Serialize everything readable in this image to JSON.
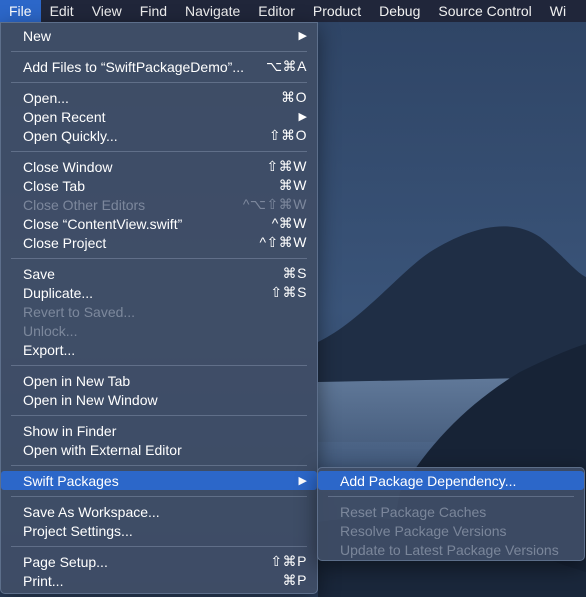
{
  "menubar": {
    "items": [
      "File",
      "Edit",
      "View",
      "Find",
      "Navigate",
      "Editor",
      "Product",
      "Debug",
      "Source Control",
      "Wi"
    ],
    "active": "File"
  },
  "file_menu": {
    "new": "New",
    "add_files": "Add Files to “SwiftPackageDemo”...",
    "add_files_shortcut": "⌥⌘A",
    "open": "Open...",
    "open_shortcut": "⌘O",
    "open_recent": "Open Recent",
    "open_quickly": "Open Quickly...",
    "open_quickly_shortcut": "⇧⌘O",
    "close_window": "Close Window",
    "close_window_shortcut": "⇧⌘W",
    "close_tab": "Close Tab",
    "close_tab_shortcut": "⌘W",
    "close_other_editors": "Close Other Editors",
    "close_other_editors_shortcut": "^⌥⇧⌘W",
    "close_contentview": "Close “ContentView.swift”",
    "close_contentview_shortcut": "^⌘W",
    "close_project": "Close Project",
    "close_project_shortcut": "^⇧⌘W",
    "save": "Save",
    "save_shortcut": "⌘S",
    "duplicate": "Duplicate...",
    "duplicate_shortcut": "⇧⌘S",
    "revert": "Revert to Saved...",
    "unlock": "Unlock...",
    "export": "Export...",
    "open_new_tab": "Open in New Tab",
    "open_new_window": "Open in New Window",
    "show_in_finder": "Show in Finder",
    "open_external": "Open with External Editor",
    "swift_packages": "Swift Packages",
    "save_workspace": "Save As Workspace...",
    "project_settings": "Project Settings...",
    "page_setup": "Page Setup...",
    "page_setup_shortcut": "⇧⌘P",
    "print": "Print...",
    "print_shortcut": "⌘P"
  },
  "swift_packages_menu": {
    "add_dependency": "Add Package Dependency...",
    "reset_caches": "Reset Package Caches",
    "resolve_versions": "Resolve Package Versions",
    "update_latest": "Update to Latest Package Versions"
  },
  "icons": {
    "submenu_arrow": "submenu-arrow-icon"
  }
}
